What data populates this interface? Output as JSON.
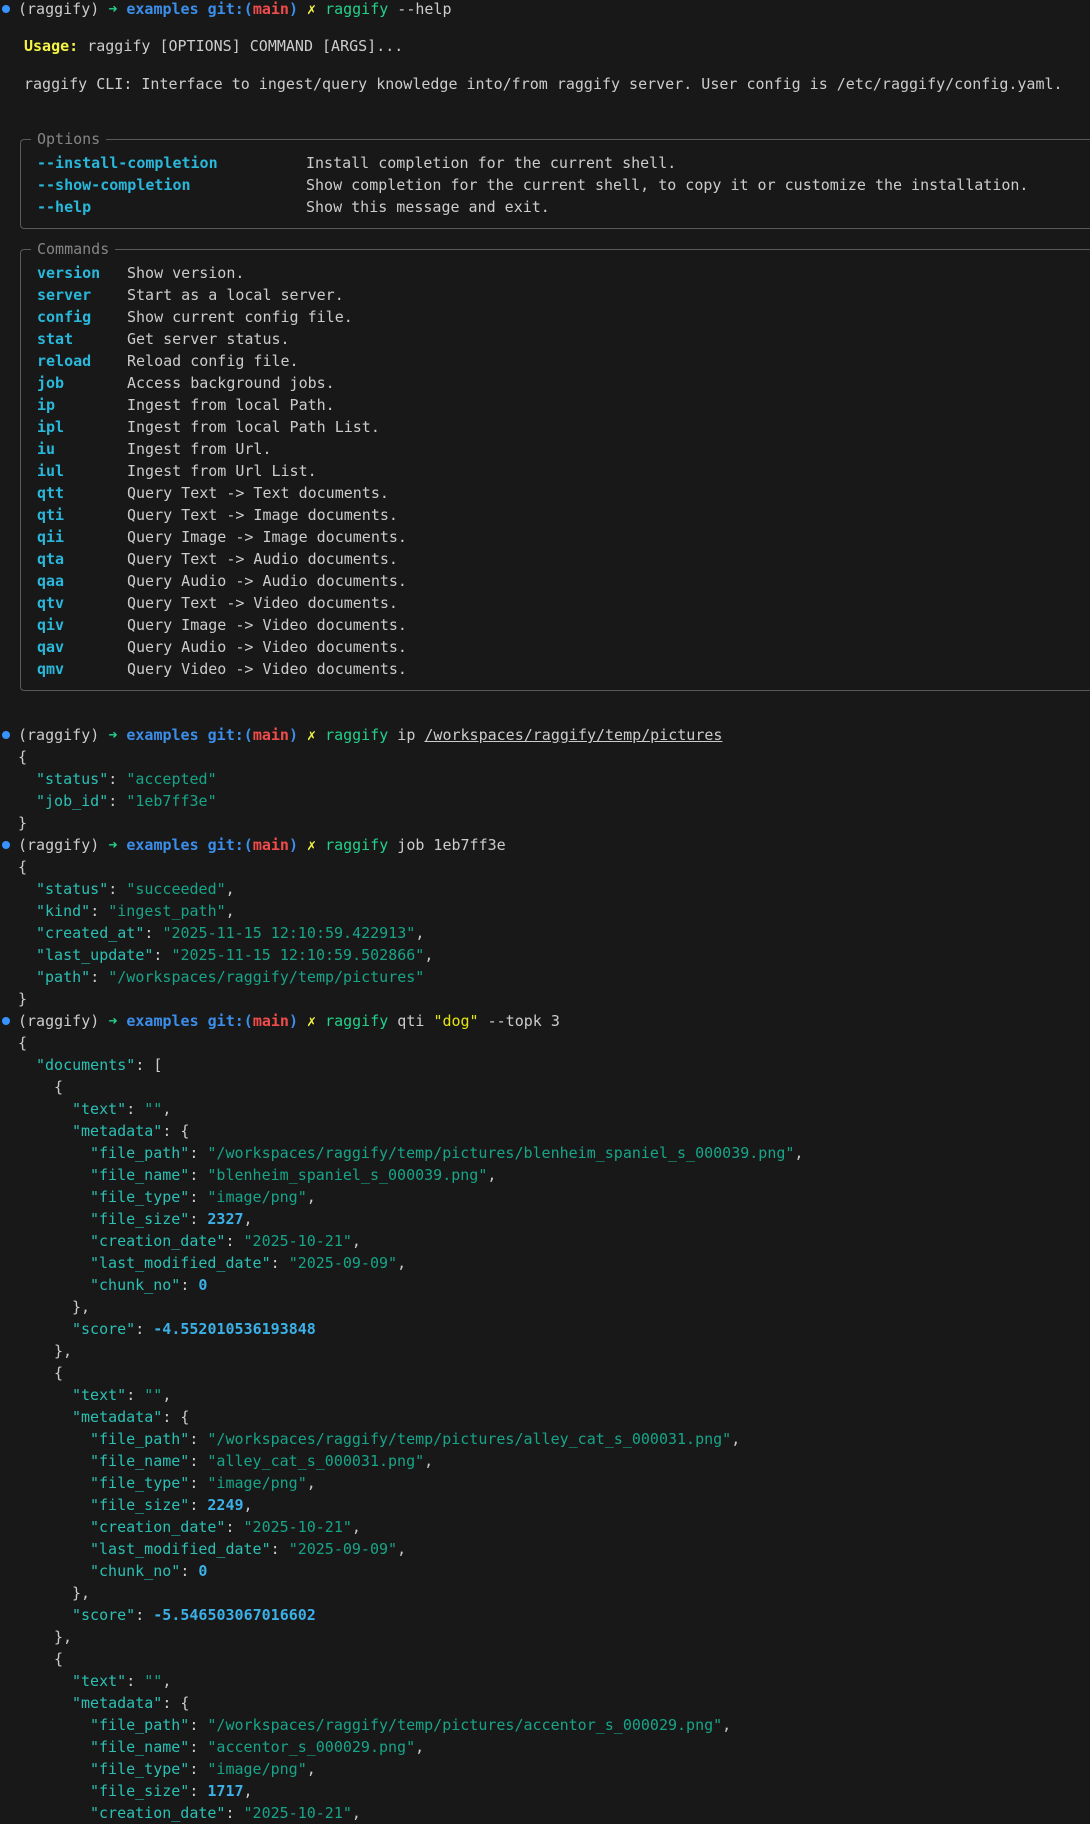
{
  "prompt": {
    "env": "(raggify)",
    "arrow": "➜",
    "dir": "examples",
    "git_label": "git:(",
    "branch": "main",
    "git_close": ")",
    "dirty": "✗"
  },
  "cmd1": {
    "prog": "raggify",
    "args": " --help"
  },
  "usage": {
    "label": "Usage:",
    "text": " raggify [OPTIONS] COMMAND [ARGS]..."
  },
  "description": "raggify CLI: Interface to ingest/query knowledge into/from raggify server. User config is /etc/raggify/config.yaml.",
  "options": {
    "title": "Options",
    "items": [
      {
        "flag": "--install-completion",
        "desc": "Install completion for the current shell."
      },
      {
        "flag": "--show-completion",
        "desc": "Show completion for the current shell, to copy it or customize the installation."
      },
      {
        "flag": "--help",
        "desc": "Show this message and exit."
      }
    ]
  },
  "commands": {
    "title": "Commands",
    "items": [
      {
        "name": "version",
        "desc": "Show version."
      },
      {
        "name": "server",
        "desc": "Start as a local server."
      },
      {
        "name": "config",
        "desc": "Show current config file."
      },
      {
        "name": "stat",
        "desc": "Get server status."
      },
      {
        "name": "reload",
        "desc": "Reload config file."
      },
      {
        "name": "job",
        "desc": "Access background jobs."
      },
      {
        "name": "ip",
        "desc": "Ingest from local Path."
      },
      {
        "name": "ipl",
        "desc": "Ingest from local Path List."
      },
      {
        "name": "iu",
        "desc": "Ingest from Url."
      },
      {
        "name": "iul",
        "desc": "Ingest from Url List."
      },
      {
        "name": "qtt",
        "desc": "Query Text -> Text documents."
      },
      {
        "name": "qti",
        "desc": "Query Text -> Image documents."
      },
      {
        "name": "qii",
        "desc": "Query Image -> Image documents."
      },
      {
        "name": "qta",
        "desc": "Query Text -> Audio documents."
      },
      {
        "name": "qaa",
        "desc": "Query Audio -> Audio documents."
      },
      {
        "name": "qtv",
        "desc": "Query Text -> Video documents."
      },
      {
        "name": "qiv",
        "desc": "Query Image -> Video documents."
      },
      {
        "name": "qav",
        "desc": "Query Audio -> Video documents."
      },
      {
        "name": "qmv",
        "desc": "Query Video -> Video documents."
      }
    ]
  },
  "cmd2": {
    "prog": "raggify",
    "sub": " ip ",
    "path": "/workspaces/raggify/temp/pictures"
  },
  "resp2": {
    "status": "\"accepted\"",
    "job_id": "\"1eb7ff3e\""
  },
  "cmd3": {
    "prog": "raggify",
    "args": " job 1eb7ff3e"
  },
  "resp3": {
    "status": "\"succeeded\"",
    "kind": "\"ingest_path\"",
    "created_at": "\"2025-11-15 12:10:59.422913\"",
    "last_update": "\"2025-11-15 12:10:59.502866\"",
    "path": "\"/workspaces/raggify/temp/pictures\""
  },
  "cmd4": {
    "prog": "raggify",
    "sub": " qti ",
    "query": "\"dog\"",
    "rest": " --topk 3"
  },
  "docs": [
    {
      "text": "\"\"",
      "file_path": "\"/workspaces/raggify/temp/pictures/blenheim_spaniel_s_000039.png\"",
      "file_name": "\"blenheim_spaniel_s_000039.png\"",
      "file_type": "\"image/png\"",
      "file_size": "2327",
      "creation_date": "\"2025-10-21\"",
      "last_modified_date": "\"2025-09-09\"",
      "chunk_no": "0",
      "score": "-4.552010536193848"
    },
    {
      "text": "\"\"",
      "file_path": "\"/workspaces/raggify/temp/pictures/alley_cat_s_000031.png\"",
      "file_name": "\"alley_cat_s_000031.png\"",
      "file_type": "\"image/png\"",
      "file_size": "2249",
      "creation_date": "\"2025-10-21\"",
      "last_modified_date": "\"2025-09-09\"",
      "chunk_no": "0",
      "score": "-5.546503067016602"
    },
    {
      "text": "\"\"",
      "file_path": "\"/workspaces/raggify/temp/pictures/accentor_s_000029.png\"",
      "file_name": "\"accentor_s_000029.png\"",
      "file_type": "\"image/png\"",
      "file_size": "1717",
      "creation_date": "\"2025-10-21\""
    }
  ]
}
